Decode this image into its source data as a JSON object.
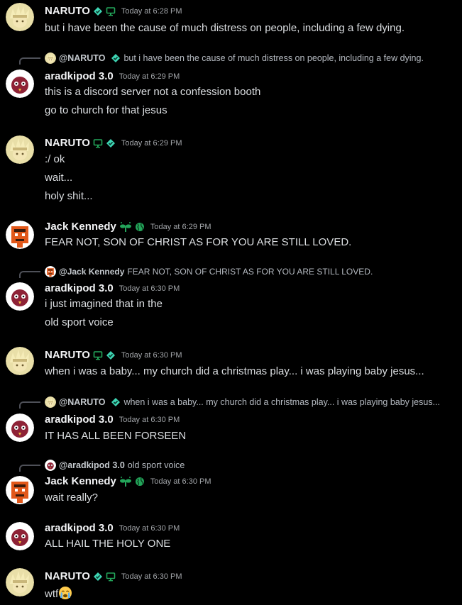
{
  "messages": [
    {
      "author": "NARUTO",
      "avatar": "naruto",
      "badges": [
        "diamond-badge",
        "monitor-badge"
      ],
      "timestamp": "Today at 6:28 PM",
      "lines": [
        "but i have been the cause of much distress on people, including a few dying."
      ]
    },
    {
      "reply": {
        "avatar": "naruto",
        "name": "@NARUTO",
        "badge": "diamond-badge",
        "text": "but i have been the cause of much distress on people, including a few dying."
      },
      "author": "aradkipod 3.0",
      "avatar": "aradkipod",
      "badges": [],
      "timestamp": "Today at 6:29 PM",
      "lines": [
        "this is a discord server not a confession booth",
        "go to church for that jesus"
      ]
    },
    {
      "author": "NARUTO",
      "avatar": "naruto",
      "badges": [
        "monitor-badge",
        "diamond-badge"
      ],
      "timestamp": "Today at 6:29 PM",
      "lines": [
        ":/ ok",
        "wait...",
        "holy shit..."
      ]
    },
    {
      "author": "Jack Kennedy",
      "avatar": "jack",
      "badges": [
        "sprout-badge",
        "globe-badge"
      ],
      "timestamp": "Today at 6:29 PM",
      "lines": [
        "FEAR NOT, SON OF CHRIST AS FOR YOU ARE STILL LOVED."
      ]
    },
    {
      "reply": {
        "avatar": "jack",
        "name": "@Jack Kennedy",
        "badge": "",
        "text": "FEAR NOT, SON OF CHRIST AS FOR YOU ARE STILL LOVED."
      },
      "author": "aradkipod 3.0",
      "avatar": "aradkipod",
      "badges": [],
      "timestamp": "Today at 6:30 PM",
      "lines": [
        "i just imagined that in the",
        "old sport voice"
      ]
    },
    {
      "author": "NARUTO",
      "avatar": "naruto",
      "badges": [
        "monitor-badge",
        "diamond-badge"
      ],
      "timestamp": "Today at 6:30 PM",
      "lines": [
        "when i was a baby... my church did a christmas play... i was playing baby jesus..."
      ]
    },
    {
      "reply": {
        "avatar": "naruto",
        "name": "@NARUTO",
        "badge": "diamond-badge",
        "text": "when i was a baby... my church did a christmas play... i was playing baby jesus..."
      },
      "author": "aradkipod 3.0",
      "avatar": "aradkipod",
      "badges": [],
      "timestamp": "Today at 6:30 PM",
      "lines": [
        "IT HAS ALL BEEN FORSEEN"
      ]
    },
    {
      "reply": {
        "avatar": "aradkipod",
        "name": "@aradkipod 3.0",
        "badge": "",
        "text": "old sport voice"
      },
      "author": "Jack Kennedy",
      "avatar": "jack",
      "badges": [
        "sprout-badge",
        "globe-badge"
      ],
      "timestamp": "Today at 6:30 PM",
      "lines": [
        "wait really?"
      ]
    },
    {
      "author": "aradkipod 3.0",
      "avatar": "aradkipod",
      "badges": [],
      "timestamp": "Today at 6:30 PM",
      "lines": [
        "ALL HAIL THE HOLY ONE"
      ]
    },
    {
      "author": "NARUTO",
      "avatar": "naruto",
      "badges": [
        "diamond-badge",
        "monitor-badge"
      ],
      "timestamp": "Today at 6:30 PM",
      "lines": [
        "wtf"
      ],
      "trailing_emoji": "crying-face-emoji"
    }
  ],
  "colors": {
    "background": "#000000",
    "username": "#f2f3f5",
    "text": "#dbdee1",
    "timestamp": "#a3a6aa",
    "badge_green": "#23a55a",
    "badge_teal": "#3ed6b4"
  }
}
